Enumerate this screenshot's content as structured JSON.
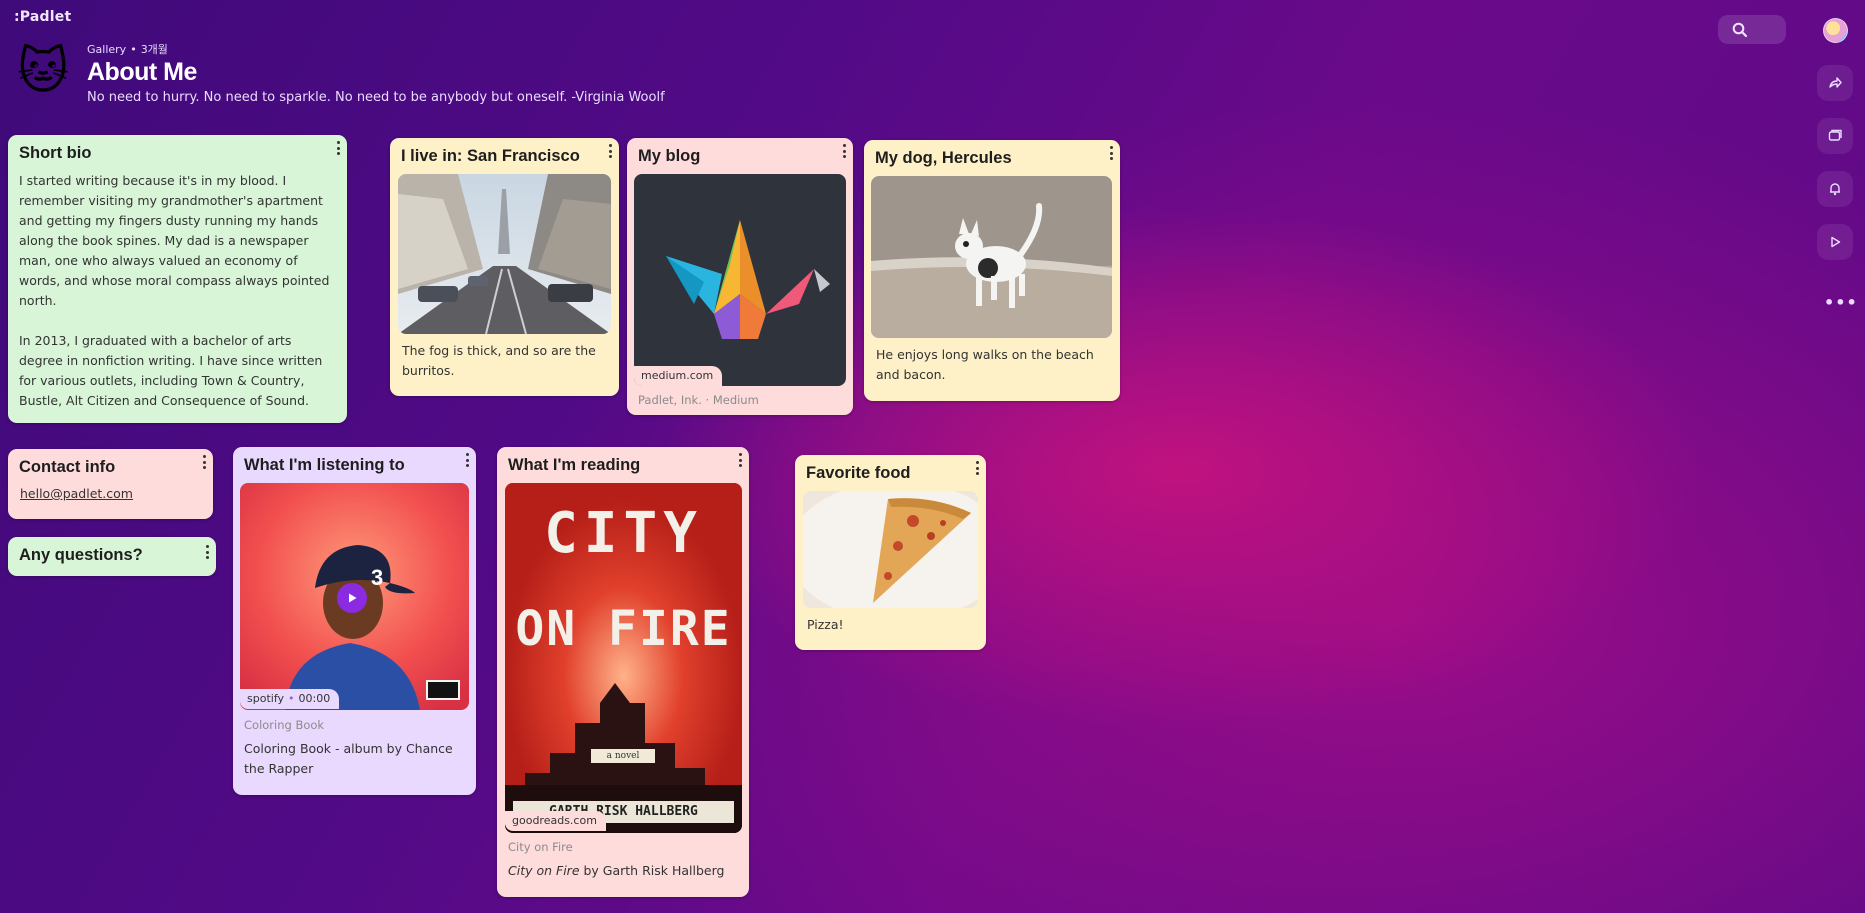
{
  "app": {
    "logo": ":Padlet"
  },
  "header": {
    "crumb_gallery": "Gallery",
    "crumb_count": "3개월",
    "title": "About Me",
    "subtitle": "No need to hurry. No need to sparkle. No need to be anybody but oneself. -Virginia Woolf",
    "avatar_emoji": "🐱"
  },
  "toolbar": {
    "icons": [
      "search-icon",
      "profile-avatar",
      "share-icon",
      "remake-icon",
      "bell-icon",
      "play-icon",
      "more-icon"
    ]
  },
  "cards": {
    "bio": {
      "title": "Short bio",
      "para1": "I started writing because it's in my blood. I remember visiting my grandmother's apartment and getting my fingers dusty running my hands along the book spines. My dad is a newspaper man, one who always valued an economy of words, and whose moral compass always pointed north.",
      "para2": "In 2013, I graduated with a bachelor of arts degree in nonfiction writing. I have since written for various outlets, including Town & Country, Bustle, Alt Citizen and Consequence of Sound."
    },
    "sf": {
      "title": "I live in: San Francisco",
      "body": "The fog is thick, and so are the burritos."
    },
    "blog": {
      "title": "My blog",
      "source": "medium.com",
      "meta": "Padlet, Ink. · Medium"
    },
    "dog": {
      "title": "My dog, Hercules",
      "body": "He enjoys long walks on the beach and bacon."
    },
    "contact": {
      "title": "Contact info",
      "email": "hello@padlet.com"
    },
    "questions": {
      "title": "Any questions?"
    },
    "listening": {
      "title": "What I'm listening to",
      "source": "spotify",
      "duration": "00:00",
      "meta": "Coloring Book",
      "body": "Coloring Book - album by Chance the Rapper",
      "cover_text": "3"
    },
    "reading": {
      "title": "What I'm reading",
      "source": "goodreads.com",
      "meta": "City on Fire",
      "body_italic": "City on Fire",
      "body_rest": " by Garth Risk Hallberg",
      "cover_line1": "CITY",
      "cover_line2": "ON FIRE",
      "cover_sub": "a novel",
      "cover_author": "GARTH RISK HALLBERG"
    },
    "food": {
      "title": "Favorite food",
      "body": "Pizza!"
    }
  },
  "colors": {
    "green": "#d8f5d8",
    "pink": "#ffdcdc",
    "yellow": "#fff1c7",
    "lavender": "#ead9ff"
  }
}
